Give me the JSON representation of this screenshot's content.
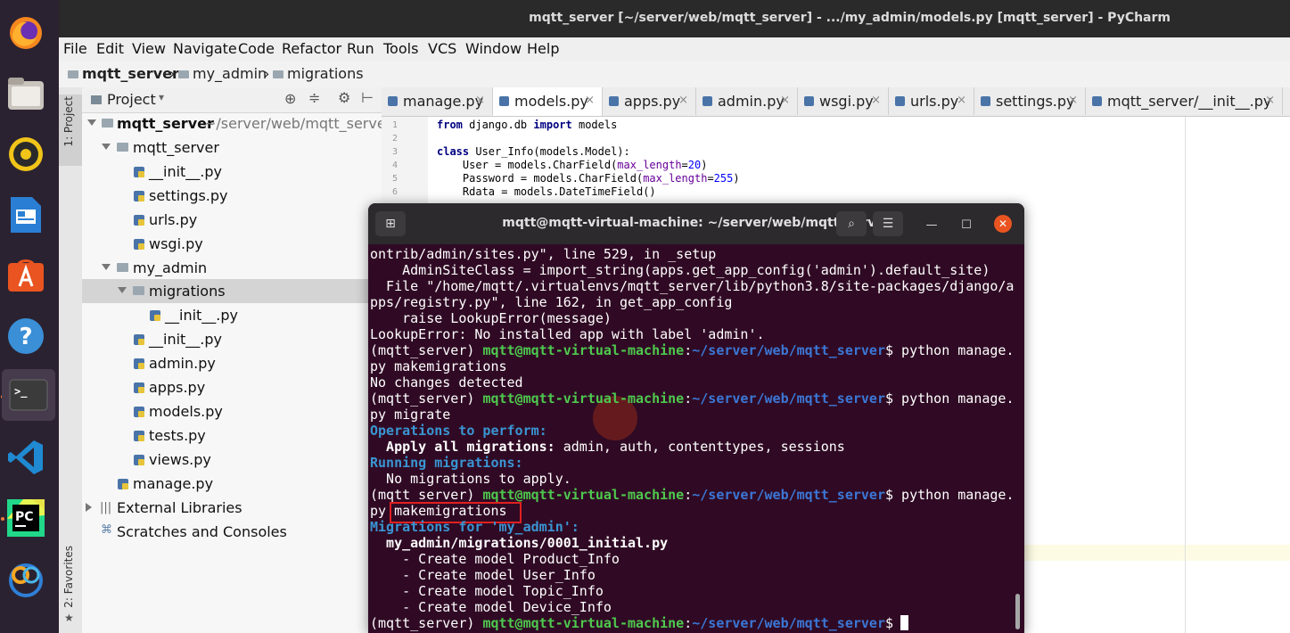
{
  "window": {
    "title": "mqtt_server [~/server/web/mqtt_server] - .../my_admin/models.py [mqtt_server] - PyCharm"
  },
  "dock": {
    "apps": [
      {
        "name": "firefox-icon"
      },
      {
        "name": "files-icon"
      },
      {
        "name": "rhythmbox-icon"
      },
      {
        "name": "writer-icon"
      },
      {
        "name": "software-center-icon"
      },
      {
        "name": "help-icon"
      },
      {
        "name": "terminal-icon"
      },
      {
        "name": "vscode-icon"
      },
      {
        "name": "pycharm-icon"
      },
      {
        "name": "app-icon"
      }
    ],
    "colors": {
      "bg": "#2b2231",
      "accent": "#f07c3a"
    },
    "terminal_glyph": ">_",
    "pycharm_glyph": "PC"
  },
  "menu": [
    "File",
    "Edit",
    "View",
    "Navigate",
    "Code",
    "Refactor",
    "Run",
    "Tools",
    "VCS",
    "Window",
    "Help"
  ],
  "breadcrumb": [
    "mqtt_server",
    "my_admin",
    "migrations"
  ],
  "side_tabs": {
    "project": "1: Project",
    "favorites": "2: Favorites"
  },
  "project": {
    "header": "Project",
    "root_name": "mqtt_server",
    "root_path": "~/server/web/mqtt_server",
    "items": [
      {
        "label": "mqtt_server"
      },
      {
        "label": "__init__.py"
      },
      {
        "label": "settings.py"
      },
      {
        "label": "urls.py"
      },
      {
        "label": "wsgi.py"
      },
      {
        "label": "my_admin"
      },
      {
        "label": "migrations"
      },
      {
        "label": "__init__.py"
      },
      {
        "label": "__init__.py"
      },
      {
        "label": "admin.py"
      },
      {
        "label": "apps.py"
      },
      {
        "label": "models.py"
      },
      {
        "label": "tests.py"
      },
      {
        "label": "views.py"
      },
      {
        "label": "manage.py"
      },
      {
        "label": "External Libraries"
      },
      {
        "label": "Scratches and Consoles"
      }
    ]
  },
  "tabs": [
    {
      "label": "manage.py"
    },
    {
      "label": "models.py"
    },
    {
      "label": "apps.py"
    },
    {
      "label": "admin.py"
    },
    {
      "label": "wsgi.py"
    },
    {
      "label": "urls.py"
    },
    {
      "label": "settings.py"
    },
    {
      "label": "mqtt_server/__init__.py"
    }
  ],
  "editor": {
    "line_numbers": [
      "1",
      "2",
      "3",
      "4",
      "5",
      "6"
    ],
    "code": {
      "l1_kw1": "from",
      "l1_mid": " django.db ",
      "l1_kw2": "import",
      "l1_end": " models",
      "l3_kw": "class",
      "l3_rest": " User_Info(models.Model):",
      "l4_a": "    User = models.CharField(",
      "l4_arg": "max_length",
      "l4_eq": "=",
      "l4_num": "20",
      "l4_end": ")",
      "l5_a": "    Password = models.CharField(",
      "l5_arg": "max_length",
      "l5_eq": "=",
      "l5_num": "255",
      "l5_end": ")",
      "l6": "    Rdata = models.DateTimeField()"
    }
  },
  "terminal": {
    "title": "mqtt@mqtt-virtual-machine: ~/server/web/mqtt_server",
    "env": "(mqtt_server)",
    "user_host": "mqtt@mqtt-virtual-machine",
    "path": "~/server/web/mqtt_server",
    "lines": {
      "l1": "ontrib/admin/sites.py\", line 529, in _setup",
      "l2": "    AdminSiteClass = import_string(apps.get_app_config('admin').default_site)",
      "l3": "  File \"/home/mqtt/.virtualenvs/mqtt_server/lib/python3.8/site-packages/django/a",
      "l4": "pps/registry.py\", line 162, in get_app_config",
      "l5": "    raise LookupError(message)",
      "l6": "LookupError: No installed app with label 'admin'.",
      "cmd1": "$ python manage.",
      "l8": "py makemigrations",
      "l9": "No changes detected",
      "cmd2": "$ python manage.",
      "l11": "py migrate",
      "l12": "Operations to perform:",
      "l13_bold": "  Apply all migrations:",
      "l13_rest": " admin, auth, contenttypes, sessions",
      "l14": "Running migrations:",
      "l15": "  No migrations to apply.",
      "cmd3": "$ python manage.",
      "l17_a": "py ",
      "l17_b": "makemigrations",
      "l18": "Migrations for 'my_admin':",
      "l19": "  my_admin/migrations/0001_initial.py",
      "l20": "    - Create model Product_Info",
      "l21": "    - Create model User_Info",
      "l22": "    - Create model Topic_Info",
      "l23": "    - Create model Device_Info",
      "prompt_end": "$ "
    },
    "colors": {
      "bg": "#300a24",
      "green": "#4ec94e",
      "blue": "#3b77d6",
      "highlight": "#e02020"
    }
  }
}
